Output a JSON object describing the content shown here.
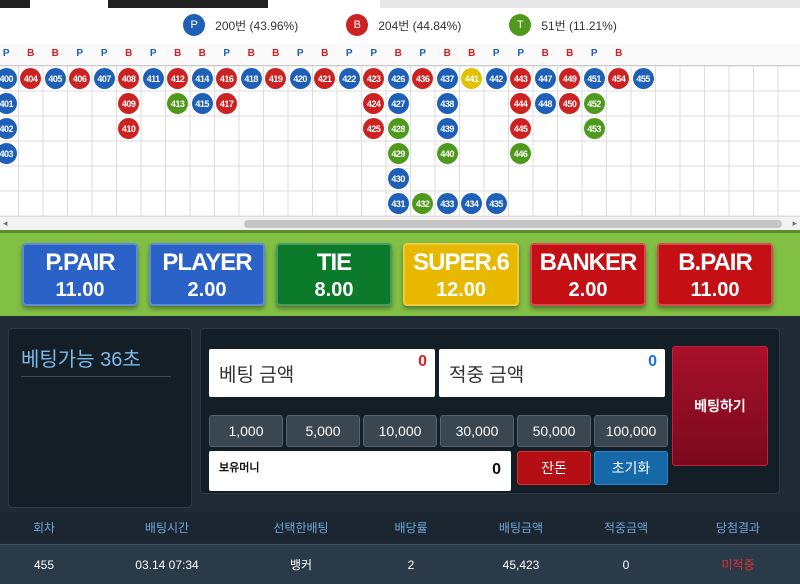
{
  "stats": {
    "player": {
      "badge": "P",
      "text": "200번 (43.96%)",
      "color": "#1e5fb8"
    },
    "banker": {
      "badge": "B",
      "text": "204번 (44.84%)",
      "color": "#cc2222"
    },
    "tie": {
      "badge": "T",
      "text": "51번 (11.21%)",
      "color": "#4f9a1c"
    }
  },
  "road": {
    "header": [
      "P",
      "B",
      "B",
      "P",
      "P",
      "B",
      "P",
      "B",
      "B",
      "P",
      "B",
      "B",
      "P",
      "B",
      "P",
      "P",
      "B",
      "P",
      "B",
      "B",
      "P",
      "P",
      "B",
      "B",
      "P",
      "B"
    ],
    "columns": [
      {
        "col": 0,
        "cells": [
          {
            "n": "400",
            "t": "P",
            "r": 0
          },
          {
            "n": "401",
            "t": "P",
            "r": 1
          },
          {
            "n": "402",
            "t": "P",
            "r": 2
          },
          {
            "n": "403",
            "t": "P",
            "r": 3
          }
        ]
      },
      {
        "col": 1,
        "cells": [
          {
            "n": "404",
            "t": "B",
            "r": 0
          }
        ]
      },
      {
        "col": 2,
        "cells": [
          {
            "n": "405",
            "t": "P",
            "r": 0
          }
        ]
      },
      {
        "col": 3,
        "cells": [
          {
            "n": "406",
            "t": "B",
            "r": 0
          }
        ]
      },
      {
        "col": 4,
        "cells": [
          {
            "n": "407",
            "t": "P",
            "r": 0
          }
        ]
      },
      {
        "col": 5,
        "cells": [
          {
            "n": "408",
            "t": "B",
            "r": 0
          },
          {
            "n": "409",
            "t": "B",
            "r": 1
          },
          {
            "n": "410",
            "t": "B",
            "r": 2
          }
        ]
      },
      {
        "col": 6,
        "cells": [
          {
            "n": "411",
            "t": "P",
            "r": 0
          }
        ]
      },
      {
        "col": 7,
        "cells": [
          {
            "n": "412",
            "t": "B",
            "r": 0
          },
          {
            "n": "413",
            "t": "T",
            "r": 1
          }
        ]
      },
      {
        "col": 8,
        "cells": [
          {
            "n": "414",
            "t": "P",
            "r": 0
          },
          {
            "n": "415",
            "t": "P",
            "r": 1
          }
        ]
      },
      {
        "col": 9,
        "cells": [
          {
            "n": "416",
            "t": "B",
            "r": 0
          },
          {
            "n": "417",
            "t": "B",
            "r": 1
          }
        ]
      },
      {
        "col": 10,
        "cells": [
          {
            "n": "418",
            "t": "P",
            "r": 0
          }
        ]
      },
      {
        "col": 11,
        "cells": [
          {
            "n": "419",
            "t": "B",
            "r": 0
          }
        ]
      },
      {
        "col": 12,
        "cells": [
          {
            "n": "420",
            "t": "P",
            "r": 0
          }
        ]
      },
      {
        "col": 13,
        "cells": [
          {
            "n": "421",
            "t": "B",
            "r": 0
          }
        ]
      },
      {
        "col": 14,
        "cells": [
          {
            "n": "422",
            "t": "P",
            "r": 0
          }
        ]
      },
      {
        "col": 15,
        "cells": [
          {
            "n": "423",
            "t": "B",
            "r": 0
          },
          {
            "n": "424",
            "t": "B",
            "r": 1
          },
          {
            "n": "425",
            "t": "B",
            "r": 2
          }
        ]
      },
      {
        "col": 16,
        "cells": [
          {
            "n": "426",
            "t": "P",
            "r": 0
          },
          {
            "n": "427",
            "t": "P",
            "r": 1
          },
          {
            "n": "428",
            "t": "T",
            "r": 2
          },
          {
            "n": "429",
            "t": "T",
            "r": 3
          },
          {
            "n": "430",
            "t": "P",
            "r": 4
          },
          {
            "n": "431",
            "t": "P",
            "r": 5
          }
        ]
      },
      {
        "col": 17,
        "cells": [
          {
            "n": "436",
            "t": "B",
            "r": 0
          },
          {
            "n": "432",
            "t": "T",
            "r": 5
          }
        ]
      },
      {
        "col": 18,
        "cells": [
          {
            "n": "437",
            "t": "P",
            "r": 0
          },
          {
            "n": "438",
            "t": "P",
            "r": 1
          },
          {
            "n": "439",
            "t": "P",
            "r": 2
          },
          {
            "n": "440",
            "t": "T",
            "r": 3
          },
          {
            "n": "433",
            "t": "P",
            "r": 5
          }
        ]
      },
      {
        "col": 19,
        "cells": [
          {
            "n": "441",
            "t": "Y",
            "r": 0
          },
          {
            "n": "434",
            "t": "P",
            "r": 5
          }
        ]
      },
      {
        "col": 20,
        "cells": [
          {
            "n": "442",
            "t": "P",
            "r": 0
          },
          {
            "n": "435",
            "t": "P",
            "r": 5
          }
        ]
      },
      {
        "col": 21,
        "cells": [
          {
            "n": "443",
            "t": "B",
            "r": 0
          },
          {
            "n": "444",
            "t": "B",
            "r": 1
          },
          {
            "n": "445",
            "t": "B",
            "r": 2
          },
          {
            "n": "446",
            "t": "T",
            "r": 3
          }
        ]
      },
      {
        "col": 22,
        "cells": [
          {
            "n": "447",
            "t": "P",
            "r": 0
          },
          {
            "n": "448",
            "t": "P",
            "r": 1
          }
        ]
      },
      {
        "col": 23,
        "cells": [
          {
            "n": "449",
            "t": "B",
            "r": 0
          },
          {
            "n": "450",
            "t": "B",
            "r": 1
          }
        ]
      },
      {
        "col": 24,
        "cells": [
          {
            "n": "451",
            "t": "P",
            "r": 0
          },
          {
            "n": "452",
            "t": "T",
            "r": 1
          },
          {
            "n": "453",
            "t": "T",
            "r": 2
          }
        ]
      },
      {
        "col": 25,
        "cells": [
          {
            "n": "454",
            "t": "B",
            "r": 0
          }
        ]
      },
      {
        "col": 26,
        "cells": [
          {
            "n": "455",
            "t": "P",
            "r": 0
          }
        ]
      }
    ],
    "colors": {
      "P": "#1e5fb8",
      "B": "#cc2222",
      "T": "#4f9a1c",
      "Y": "#e5c000"
    }
  },
  "bets": [
    {
      "name": "P.PAIR",
      "odds": "11.00",
      "color": "#2b62c8"
    },
    {
      "name": "PLAYER",
      "odds": "2.00",
      "color": "#2b62c8"
    },
    {
      "name": "TIE",
      "odds": "8.00",
      "color": "#0b7a2a"
    },
    {
      "name": "SUPER.6",
      "odds": "12.00",
      "color": "#e8b800"
    },
    {
      "name": "BANKER",
      "odds": "2.00",
      "color": "#c40f14"
    },
    {
      "name": "B.PAIR",
      "odds": "11.00",
      "color": "#c40f14"
    }
  ],
  "control": {
    "timer": "베팅가능 36초",
    "bet_amount_label": "베팅 금액",
    "bet_amount_value": "0",
    "win_amount_label": "적중 금액",
    "win_amount_value": "0",
    "chips": [
      "1,000",
      "5,000",
      "10,000",
      "30,000",
      "50,000",
      "100,000"
    ],
    "holding_label": "보유머니",
    "holding_value": "0",
    "change_label": "잔돈",
    "reset_label": "초기화",
    "place_label": "베팅하기"
  },
  "history": {
    "headers": [
      "회차",
      "배팅시간",
      "선택한배팅",
      "배당률",
      "배팅금액",
      "적중금액",
      "당첨결과"
    ],
    "rows": [
      [
        "455",
        "03.14 07:34",
        "뱅커",
        "2",
        "45,423",
        "0",
        "미적중"
      ]
    ]
  }
}
